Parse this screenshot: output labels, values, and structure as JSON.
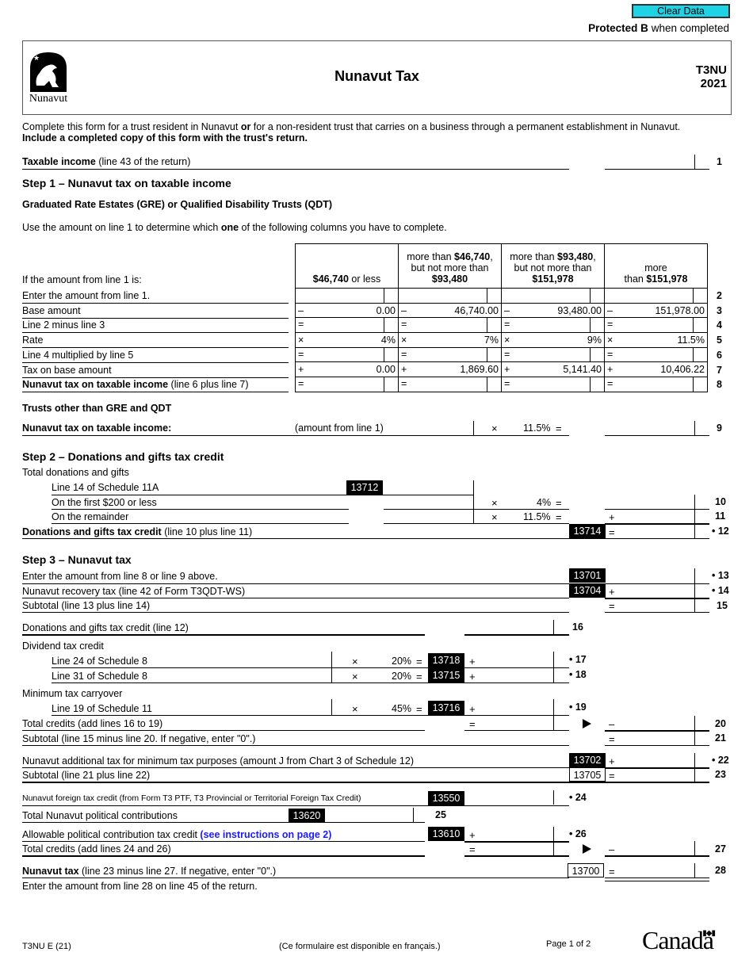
{
  "toolbar": {
    "clear_label": "Clear Data"
  },
  "protected": {
    "bold": "Protected B",
    "rest": " when completed"
  },
  "header": {
    "title": "Nunavut Tax",
    "form_code": "T3NU",
    "year": "2021",
    "logo_text": "Nunavut",
    "logo_icon": "polar-bear-emblem-icon"
  },
  "intro": {
    "line1_a": "Complete this form for a trust resident in Nunavut ",
    "line1_b": "or",
    "line1_c": " for a non-resident trust that carries on a business through a permanent establishment in Nunavut.",
    "line2": "Include a completed copy of this form with the trust's return."
  },
  "line1": {
    "label_bold": "Taxable income",
    "label_rest": " (line 43 of the return)",
    "number": "1",
    "value": ""
  },
  "step1": {
    "title": "Step 1 – Nunavut tax on taxable income",
    "subtitle": "Graduated Rate Estates (GRE) or Qualified Disability Trusts (QDT)",
    "instruction_a": "Use the amount on line 1 to determine which ",
    "instruction_b": "one",
    "instruction_c": " of the following columns you have to complete.",
    "table_header_label": "If the amount from line 1 is:",
    "columns": [
      {
        "pre": "",
        "bold": "$46,740",
        "post": " or less",
        "line2": "",
        "line3": ""
      },
      {
        "pre": "more than ",
        "bold": "$46,740",
        "post": ",",
        "line2": "but not more than",
        "line3": "$93,480"
      },
      {
        "pre": "more than ",
        "bold": "$93,480",
        "post": ",",
        "line2": "but not more than",
        "line3": "$151,978"
      },
      {
        "pre": "more",
        "bold": "",
        "post": "",
        "line2": "than ",
        "line3": "$151,978"
      }
    ],
    "rows": [
      {
        "label": "Enter the amount from line 1.",
        "label_bold": "",
        "sym": "",
        "values": [
          "",
          "",
          "",
          ""
        ],
        "number": "2",
        "split": true
      },
      {
        "label": "Base amount",
        "label_bold": "",
        "sym": "–",
        "values": [
          "0.00",
          "46,740.00",
          "93,480.00",
          "151,978.00"
        ],
        "number": "3",
        "split": false
      },
      {
        "label": "Line 2 minus line 3",
        "label_bold": "",
        "sym": "=",
        "values": [
          "",
          "",
          "",
          ""
        ],
        "number": "4",
        "split": true
      },
      {
        "label": "Rate",
        "label_bold": "",
        "sym": "×",
        "values": [
          "4%",
          "7%",
          "9%",
          "11.5%"
        ],
        "number": "5",
        "split": false
      },
      {
        "label": "Line 4 multiplied by line 5",
        "label_bold": "",
        "sym": "=",
        "values": [
          "",
          "",
          "",
          ""
        ],
        "number": "6",
        "split": true
      },
      {
        "label": "Tax on base amount",
        "label_bold": "",
        "sym": "+",
        "values": [
          "0.00",
          "1,869.60",
          "5,141.40",
          "10,406.22"
        ],
        "number": "7",
        "split": false
      },
      {
        "label": " (line 6 plus line 7)",
        "label_bold": "Nunavut tax on taxable income",
        "sym": "=",
        "values": [
          "",
          "",
          "",
          ""
        ],
        "number": "8",
        "split": true
      }
    ],
    "other_title": "Trusts other than GRE and QDT",
    "line9": {
      "label": "Nunavut tax on taxable income:",
      "hint": "(amount from line 1)",
      "op": "×",
      "rate": "11.5%",
      "eq": "=",
      "number": "9"
    }
  },
  "step2": {
    "title": "Step 2 – Donations and gifts tax credit",
    "total_label": "Total donations and gifts",
    "sched_label": "Line 14 of Schedule 11A",
    "sched_code": "13712",
    "line10": {
      "label": "On the first $200 or less",
      "op": "×",
      "rate": "4%",
      "eq": "=",
      "number": "10"
    },
    "line11": {
      "label": "On the remainder",
      "op": "×",
      "rate": "11.5%",
      "eq": "=",
      "plus": "+",
      "number": "11"
    },
    "line12": {
      "label_bold": "Donations and gifts tax credit",
      "label_rest": " (line 10 plus line 11)",
      "code": "13714",
      "eq": "=",
      "number": "12"
    }
  },
  "step3": {
    "title": "Step 3 – Nunavut tax",
    "line13": {
      "label": "Enter the amount from line 8 or line 9 above.",
      "code": "13701",
      "number": "13"
    },
    "line14": {
      "label": "Nunavut recovery tax (line 42 of Form T3QDT-WS)",
      "code": "13704",
      "op": "+",
      "number": "14"
    },
    "line15": {
      "label": "Subtotal (line 13 plus line 14)",
      "op": "=",
      "number": "15"
    },
    "line16": {
      "label": "Donations and gifts tax credit (line 12)",
      "number": "16"
    },
    "dividend_title": "Dividend tax credit",
    "line17": {
      "label": "Line 24 of Schedule 8",
      "op": "×",
      "rate": "20%",
      "eq": "=",
      "code": "13718",
      "plus": "+",
      "number": "17"
    },
    "line18": {
      "label": "Line 31 of Schedule 8",
      "op": "×",
      "rate": "20%",
      "eq": "=",
      "code": "13715",
      "plus": "+",
      "number": "18"
    },
    "mintax_title": "Minimum tax carryover",
    "line19": {
      "label": "Line 19 of Schedule 11",
      "op": "×",
      "rate": "45%",
      "eq": "=",
      "code": "13716",
      "plus": "+",
      "number": "19"
    },
    "line20": {
      "label": "Total credits (add lines 16 to 19)",
      "eq": "=",
      "minus": "–",
      "number": "20"
    },
    "line21": {
      "label": "Subtotal (line 15 minus line 20. If negative, enter \"0\".)",
      "eq": "=",
      "number": "21"
    },
    "line22": {
      "label": "Nunavut additional tax for minimum tax purposes (amount J from Chart 3 of Schedule 12)",
      "code": "13702",
      "op": "+",
      "number": "22"
    },
    "line23": {
      "label": "Subtotal (line 21 plus line 22)",
      "code": "13705",
      "eq": "=",
      "number": "23"
    },
    "line24": {
      "label": "Nunavut foreign tax credit (from Form T3 PTF, T3 Provincial or Territorial Foreign Tax Credit)",
      "code": "13550",
      "number": "24"
    },
    "line25": {
      "label": "Total Nunavut political contributions",
      "code": "13620",
      "number": "25"
    },
    "line26": {
      "label": "Allowable political contribution tax credit ",
      "link": "(see instructions on page 2)",
      "code": "13610",
      "op": "+",
      "number": "26"
    },
    "line27": {
      "label": "Total credits (add lines 24 and 26)",
      "eq": "=",
      "minus": "–",
      "number": "27"
    },
    "line28": {
      "label_bold": "Nunavut tax",
      "label_rest": " (line 23 minus line 27. If negative, enter \"0\".)",
      "code": "13700",
      "eq": "=",
      "number": "28"
    },
    "final_note": "Enter the amount from line 28 on line 45 of the return."
  },
  "footer": {
    "form_id": "T3NU E (21)",
    "french": "(Ce formulaire est disponible en français.)",
    "page": "Page 1 of 2",
    "wordmark": "Canada"
  }
}
